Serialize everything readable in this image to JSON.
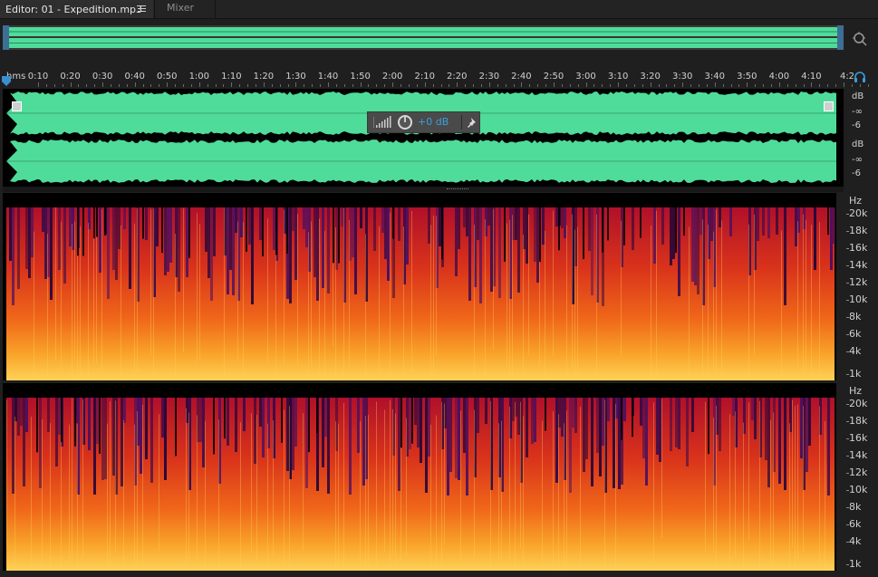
{
  "tabs": [
    {
      "label": "Editor: 01 - Expedition.mp3",
      "active": true
    },
    {
      "label": "Mixer",
      "active": false
    }
  ],
  "ruler": {
    "unit": "hms",
    "labels": [
      "0:10",
      "0:20",
      "0:30",
      "0:40",
      "0:50",
      "1:00",
      "1:10",
      "1:20",
      "1:30",
      "1:40",
      "1:50",
      "2:00",
      "2:10",
      "2:20",
      "2:30",
      "2:40",
      "2:50",
      "3:00",
      "3:10",
      "3:20",
      "3:30",
      "3:40",
      "3:50",
      "4:00",
      "4:10",
      "4:2"
    ]
  },
  "hud": {
    "gain": "+0 dB"
  },
  "db_scale": {
    "channel1": [
      "dB",
      "-∞",
      "-6"
    ],
    "channel2": [
      "dB",
      "-∞",
      "-6"
    ]
  },
  "hz_scale": [
    "Hz",
    "20k",
    "18k",
    "16k",
    "14k",
    "12k",
    "10k",
    "8k",
    "6k",
    "4k",
    "1k"
  ],
  "colors": {
    "waveform": "#4fdc9a",
    "accent": "#38a0e0",
    "overview_handle": "#3d6f96"
  },
  "icons": [
    "tab-menu-icon",
    "zoom-icon",
    "headphone-icon",
    "playhead-icon",
    "meter-icon",
    "gain-knob-icon",
    "pin-icon"
  ]
}
